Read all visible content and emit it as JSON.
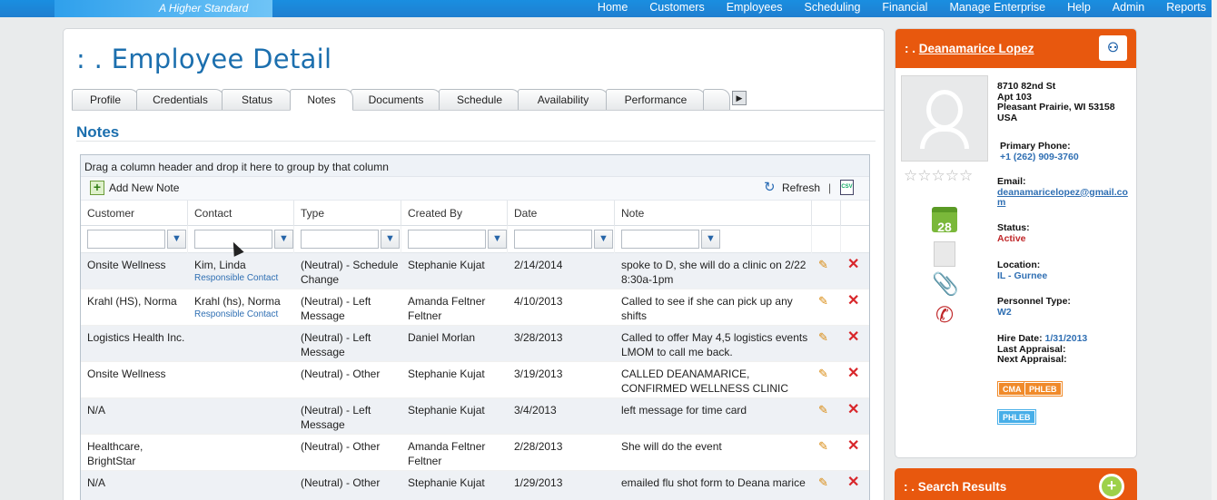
{
  "header": {
    "tagline": "A Higher Standard",
    "nav": [
      "Home",
      "Customers",
      "Employees",
      "Scheduling",
      "Financial",
      "Manage Enterprise",
      "Help",
      "Admin",
      "Reports"
    ]
  },
  "page": {
    "title": ": . Employee Detail",
    "tabs": [
      "Profile",
      "Credentials",
      "Status",
      "Notes",
      "Documents",
      "Schedule",
      "Availability",
      "Performance"
    ],
    "active_tab": "Notes",
    "section_title": "Notes"
  },
  "grid": {
    "group_hint": "Drag a column header and drop it here to group by that column",
    "add_label": "Add New Note",
    "refresh_label": "Refresh",
    "export_label": "CSV",
    "columns": [
      "Customer",
      "Contact",
      "Type",
      "Created By",
      "Date",
      "Note"
    ],
    "rows": [
      {
        "customer": "Onsite Wellness",
        "contact": "Kim, Linda",
        "contact_role": "Responsible Contact",
        "type": "(Neutral) - Schedule Change",
        "created_by": "Stephanie Kujat",
        "date": "2/14/2014",
        "note": "spoke to D, she will do a clinic on 2/22 8:30a-1pm"
      },
      {
        "customer": "Krahl (HS), Norma",
        "contact": "Krahl (hs), Norma",
        "contact_role": "Responsible Contact",
        "type": "(Neutral) - Left Message",
        "created_by": "Amanda Feltner Feltner",
        "date": "4/10/2013",
        "note": "Called to see if she can pick up any shifts"
      },
      {
        "customer": "Logistics Health Inc.",
        "contact": "",
        "contact_role": "",
        "type": "(Neutral) - Left Message",
        "created_by": "Daniel Morlan",
        "date": "3/28/2013",
        "note": "Called to offer May 4,5 logistics events LMOM to call me back."
      },
      {
        "customer": "Onsite Wellness",
        "contact": "",
        "contact_role": "",
        "type": "(Neutral) - Other",
        "created_by": "Stephanie Kujat",
        "date": "3/19/2013",
        "note": "CALLED DEANAMARICE, CONFIRMED WELLNESS CLINIC FOR SATURDAY"
      },
      {
        "customer": "N/A",
        "contact": "",
        "contact_role": "",
        "type": "(Neutral) - Left Message",
        "created_by": "Stephanie Kujat",
        "date": "3/4/2013",
        "note": "left message for time card"
      },
      {
        "customer": "Healthcare, BrightStar",
        "contact": "",
        "contact_role": "",
        "type": "(Neutral) - Other",
        "created_by": "Amanda Feltner Feltner",
        "date": "2/28/2013",
        "note": "She will do the event"
      },
      {
        "customer": "N/A",
        "contact": "",
        "contact_role": "",
        "type": "(Neutral) - Other",
        "created_by": "Stephanie Kujat",
        "date": "1/29/2013",
        "note": "emailed flu shot form to Deana marice"
      }
    ]
  },
  "employee": {
    "prefix": ": . ",
    "name": "Deanamarice Lopez",
    "address": [
      "8710 82nd St",
      "Apt 103",
      "Pleasant Prairie, WI 53158",
      "USA"
    ],
    "phone_label": "Primary Phone:",
    "phone": "+1 (262) 909-3760",
    "email_label": "Email:",
    "email": "deanamaricelopez@gmail.com",
    "status_label": "Status:",
    "status": "Active",
    "location_label": "Location:",
    "location": "IL - Gurnee",
    "personnel_label": "Personnel Type:",
    "personnel": "W2",
    "hire_label": "Hire Date:",
    "hire_date": "1/31/2013",
    "last_appraisal_label": "Last Appraisal:",
    "next_appraisal_label": "Next Appraisal:",
    "calendar_day": "28",
    "skills_row1": [
      "CMA",
      "PHLEB"
    ],
    "skills_row2": [
      "PHLEB"
    ]
  },
  "search": {
    "title": ": . Search Results"
  },
  "colors": {
    "nav_bar": "#1f7fd0",
    "title_blue": "#1c6fae",
    "panel_orange": "#e8580e",
    "status_red": "#c0282a"
  }
}
